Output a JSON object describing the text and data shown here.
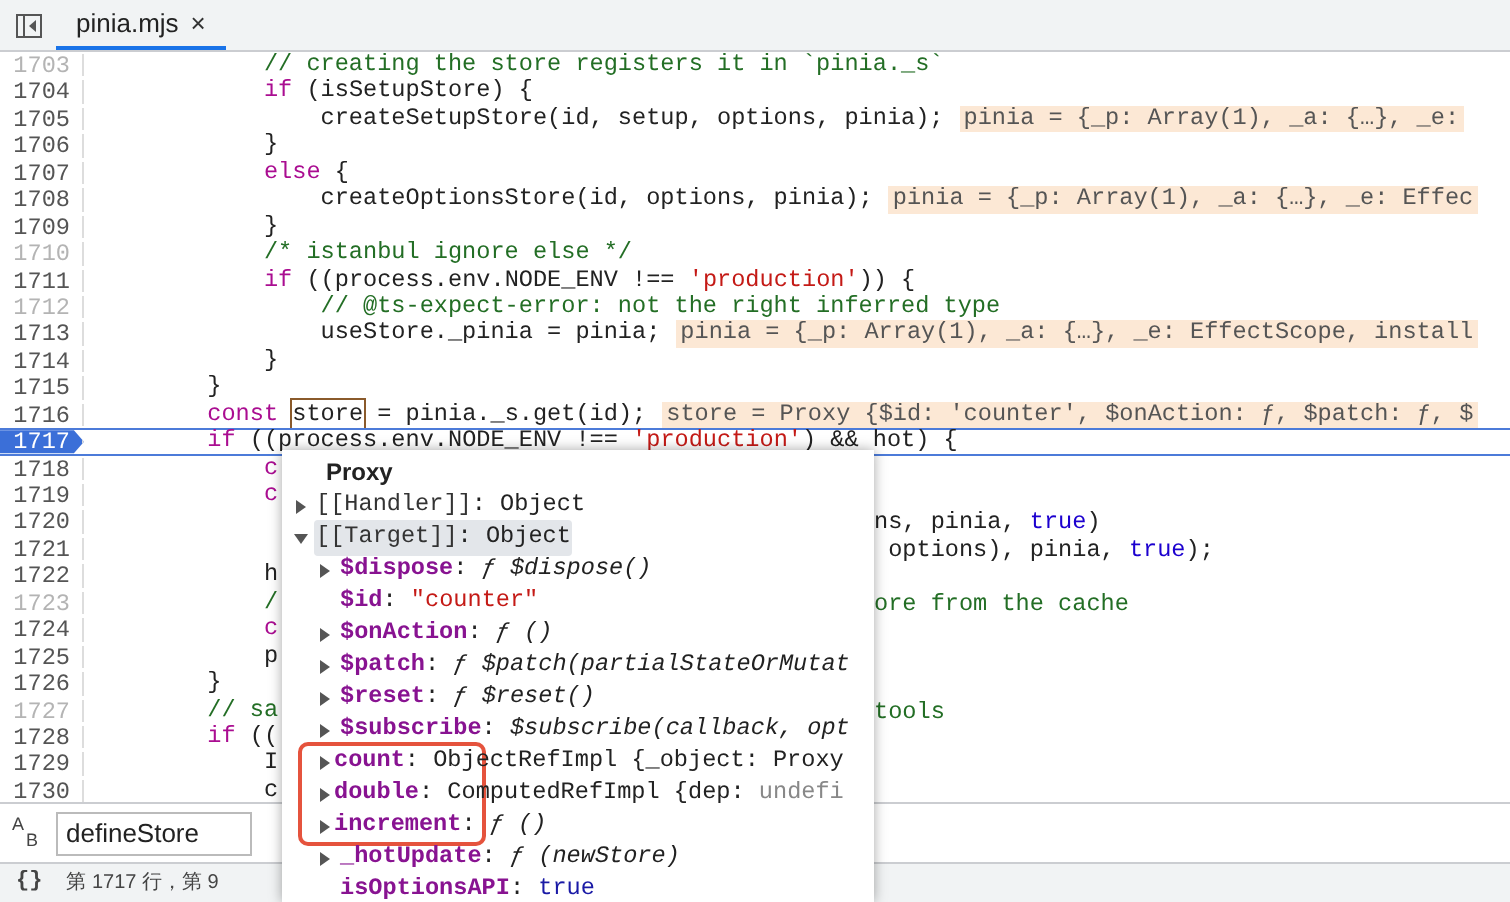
{
  "editor_tab": {
    "filename": "pinia.mjs",
    "close": "×",
    "selected": true
  },
  "code_lines": [
    {
      "number": "1703",
      "muted": true,
      "selected": false,
      "tokens": [
        {
          "kind": "comment",
          "text": "            // creating the store registers it in `pinia._s`"
        }
      ]
    },
    {
      "number": "1704",
      "muted": false,
      "selected": false,
      "tokens": [
        {
          "kind": "keyword",
          "text": "            if"
        },
        {
          "kind": "plain",
          "text": " (isSetupStore) {"
        }
      ]
    },
    {
      "number": "1705",
      "muted": false,
      "selected": false,
      "tokens": [
        {
          "kind": "plain",
          "text": "                createSetupStore(id, setup, options, pinia);"
        }
      ],
      "hint": "pinia = {_p: Array(1), _a: {…}, _e:"
    },
    {
      "number": "1706",
      "muted": false,
      "selected": false,
      "tokens": [
        {
          "kind": "plain",
          "text": "            }"
        }
      ]
    },
    {
      "number": "1707",
      "muted": false,
      "selected": false,
      "tokens": [
        {
          "kind": "keyword",
          "text": "            else"
        },
        {
          "kind": "plain",
          "text": " {"
        }
      ]
    },
    {
      "number": "1708",
      "muted": false,
      "selected": false,
      "tokens": [
        {
          "kind": "plain",
          "text": "                createOptionsStore(id, options, pinia);"
        }
      ],
      "hint": "pinia = {_p: Array(1), _a: {…}, _e: Effec"
    },
    {
      "number": "1709",
      "muted": false,
      "selected": false,
      "tokens": [
        {
          "kind": "plain",
          "text": "            }"
        }
      ]
    },
    {
      "number": "1710",
      "muted": true,
      "selected": false,
      "tokens": [
        {
          "kind": "comment",
          "text": "            /* istanbul ignore else */"
        }
      ]
    },
    {
      "number": "1711",
      "muted": false,
      "selected": false,
      "tokens": [
        {
          "kind": "keyword",
          "text": "            if"
        },
        {
          "kind": "plain",
          "text": " ((process.env.NODE_ENV !== "
        },
        {
          "kind": "string",
          "text": "'production'"
        },
        {
          "kind": "plain",
          "text": ")) {"
        }
      ]
    },
    {
      "number": "1712",
      "muted": true,
      "selected": false,
      "tokens": [
        {
          "kind": "comment",
          "text": "                // @ts-expect-error: not the right inferred type"
        }
      ]
    },
    {
      "number": "1713",
      "muted": false,
      "selected": false,
      "tokens": [
        {
          "kind": "plain",
          "text": "                useStore._pinia = pinia;"
        }
      ],
      "hint": "pinia = {_p: Array(1), _a: {…}, _e: EffectScope, install"
    },
    {
      "number": "1714",
      "muted": false,
      "selected": false,
      "tokens": [
        {
          "kind": "plain",
          "text": "            }"
        }
      ]
    },
    {
      "number": "1715",
      "muted": false,
      "selected": false,
      "tokens": [
        {
          "kind": "plain",
          "text": "        }"
        }
      ]
    },
    {
      "number": "1716",
      "muted": false,
      "selected": false,
      "tokens": [
        {
          "kind": "keyword",
          "text": "        const "
        },
        {
          "kind": "hovered",
          "text": "store"
        },
        {
          "kind": "plain",
          "text": " = pinia._s.get(id);"
        }
      ],
      "hint": "store = Proxy {$id: 'counter', $onAction: ƒ, $patch: ƒ, $"
    },
    {
      "number": "1717",
      "muted": false,
      "selected": true,
      "tokens": [
        {
          "kind": "keyword",
          "text": "        if"
        },
        {
          "kind": "plain",
          "text": " ((process.env.NODE_ENV !== "
        },
        {
          "kind": "string",
          "text": "'production'"
        },
        {
          "kind": "plain",
          "text": ") && hot) {"
        }
      ]
    },
    {
      "number": "1718",
      "muted": false,
      "selected": false,
      "tokens": [
        {
          "kind": "keyword",
          "text": "            c"
        }
      ]
    },
    {
      "number": "1719",
      "muted": false,
      "selected": false,
      "tokens": [
        {
          "kind": "keyword",
          "text": "            c"
        }
      ]
    },
    {
      "number": "1720",
      "muted": false,
      "selected": false,
      "after": [
        {
          "kind": "plain",
          "text": "ns, pinia, "
        },
        {
          "kind": "literal",
          "text": "true"
        },
        {
          "kind": "plain",
          "text": ")"
        }
      ]
    },
    {
      "number": "1721",
      "muted": false,
      "selected": false,
      "after": [
        {
          "kind": "plain",
          "text": " options), pinia, "
        },
        {
          "kind": "literal",
          "text": "true"
        },
        {
          "kind": "plain",
          "text": ");"
        }
      ]
    },
    {
      "number": "1722",
      "muted": false,
      "selected": false,
      "tokens": [
        {
          "kind": "plain",
          "text": "            h"
        }
      ]
    },
    {
      "number": "1723",
      "muted": true,
      "selected": false,
      "tokens": [
        {
          "kind": "comment",
          "text": "            /"
        }
      ],
      "after": [
        {
          "kind": "comment",
          "text": "ore from the cache"
        }
      ]
    },
    {
      "number": "1724",
      "muted": false,
      "selected": false,
      "tokens": [
        {
          "kind": "keyword",
          "text": "            c"
        }
      ]
    },
    {
      "number": "1725",
      "muted": false,
      "selected": false,
      "tokens": [
        {
          "kind": "plain",
          "text": "            p"
        }
      ]
    },
    {
      "number": "1726",
      "muted": false,
      "selected": false,
      "tokens": [
        {
          "kind": "plain",
          "text": "        }"
        }
      ]
    },
    {
      "number": "1727",
      "muted": true,
      "selected": false,
      "tokens": [
        {
          "kind": "comment",
          "text": "        // sa"
        }
      ],
      "after": [
        {
          "kind": "comment",
          "text": "tools"
        }
      ]
    },
    {
      "number": "1728",
      "muted": false,
      "selected": false,
      "tokens": [
        {
          "kind": "keyword",
          "text": "        if"
        },
        {
          "kind": "plain",
          "text": " (("
        }
      ]
    },
    {
      "number": "1729",
      "muted": false,
      "selected": false,
      "tokens": [
        {
          "kind": "plain",
          "text": "            I"
        }
      ]
    },
    {
      "number": "1730",
      "muted": false,
      "selected": false,
      "tokens": [
        {
          "kind": "plain",
          "text": "            c"
        }
      ]
    }
  ],
  "search": {
    "toggle_letters": [
      "A",
      "B"
    ],
    "value": "defineStore"
  },
  "status_bar": {
    "format_button": "{}",
    "position": "第 1717 行，第 9"
  },
  "inspector": {
    "title": "Proxy",
    "rows": [
      {
        "kind": "internal",
        "key": "[[Handler]]",
        "value": [
          {
            "kind": "plain",
            "text": ":"
          },
          {
            "kind": "plain",
            "text": "Object"
          }
        ],
        "expandable": true,
        "expanded": false,
        "selected": false,
        "highlighted": false
      },
      {
        "kind": "internal",
        "key": "[[Target]]",
        "value": [
          {
            "kind": "plain",
            "text": ":"
          },
          {
            "kind": "plain",
            "text": "Object"
          }
        ],
        "expandable": true,
        "expanded": true,
        "selected": true,
        "highlighted": false,
        "children": [
          {
            "kind": "property",
            "key": "$dispose",
            "value": [
              {
                "kind": "plain",
                "text": ":"
              },
              {
                "kind": "func",
                "text": "ƒ $dispose()"
              }
            ],
            "expandable": true,
            "expanded": false,
            "selected": false,
            "highlighted": false
          },
          {
            "kind": "property",
            "key": "$id",
            "value": [
              {
                "kind": "plain",
                "text": ":"
              },
              {
                "kind": "string",
                "text": "\"counter\""
              }
            ],
            "expandable": false,
            "selected": false,
            "highlighted": false
          },
          {
            "kind": "property",
            "key": "$onAction",
            "value": [
              {
                "kind": "plain",
                "text": ":"
              },
              {
                "kind": "func",
                "text": "ƒ ()"
              }
            ],
            "expandable": true,
            "expanded": false,
            "selected": false,
            "highlighted": false
          },
          {
            "kind": "property",
            "key": "$patch",
            "value": [
              {
                "kind": "plain",
                "text": ":"
              },
              {
                "kind": "func",
                "text": "ƒ $patch(partialStateOrMutat"
              }
            ],
            "expandable": true,
            "expanded": false,
            "selected": false,
            "highlighted": false
          },
          {
            "kind": "property",
            "key": "$reset",
            "value": [
              {
                "kind": "plain",
                "text": ":"
              },
              {
                "kind": "func",
                "text": "ƒ $reset()"
              }
            ],
            "expandable": true,
            "expanded": false,
            "selected": false,
            "highlighted": false
          },
          {
            "kind": "property",
            "key": "$subscribe",
            "value": [
              {
                "kind": "plain",
                "text": ":"
              },
              {
                "kind": "func",
                "text": "$subscribe(callback, opt"
              }
            ],
            "expandable": true,
            "expanded": false,
            "selected": false,
            "highlighted": false
          },
          {
            "kind": "property",
            "key": "count",
            "value": [
              {
                "kind": "plain",
                "text": ":"
              },
              {
                "kind": "plain",
                "text": "ObjectRefImpl {_object: Proxy"
              }
            ],
            "expandable": true,
            "expanded": false,
            "selected": false,
            "highlighted": true
          },
          {
            "kind": "property",
            "key": "double",
            "value": [
              {
                "kind": "plain",
                "text": ":"
              },
              {
                "kind": "plain",
                "text": "ComputedRefImpl {dep:"
              },
              {
                "kind": "dim",
                "text": "undefi"
              }
            ],
            "expandable": true,
            "expanded": false,
            "selected": false,
            "highlighted": true
          },
          {
            "kind": "property",
            "key": "increment",
            "value": [
              {
                "kind": "plain",
                "text": ":"
              },
              {
                "kind": "func",
                "text": "ƒ ()"
              }
            ],
            "expandable": true,
            "expanded": false,
            "selected": false,
            "highlighted": true
          },
          {
            "kind": "property",
            "key": "_hotUpdate",
            "value": [
              {
                "kind": "plain",
                "text": ":"
              },
              {
                "kind": "func",
                "text": "ƒ (newStore)"
              }
            ],
            "expandable": true,
            "expanded": false,
            "selected": false,
            "highlighted": false
          },
          {
            "kind": "property",
            "key": "isOptionsAPI",
            "value": [
              {
                "kind": "plain",
                "text": ":"
              },
              {
                "kind": "literal",
                "text": "true"
              }
            ],
            "expandable": false,
            "selected": false,
            "highlighted": false
          }
        ]
      }
    ]
  }
}
